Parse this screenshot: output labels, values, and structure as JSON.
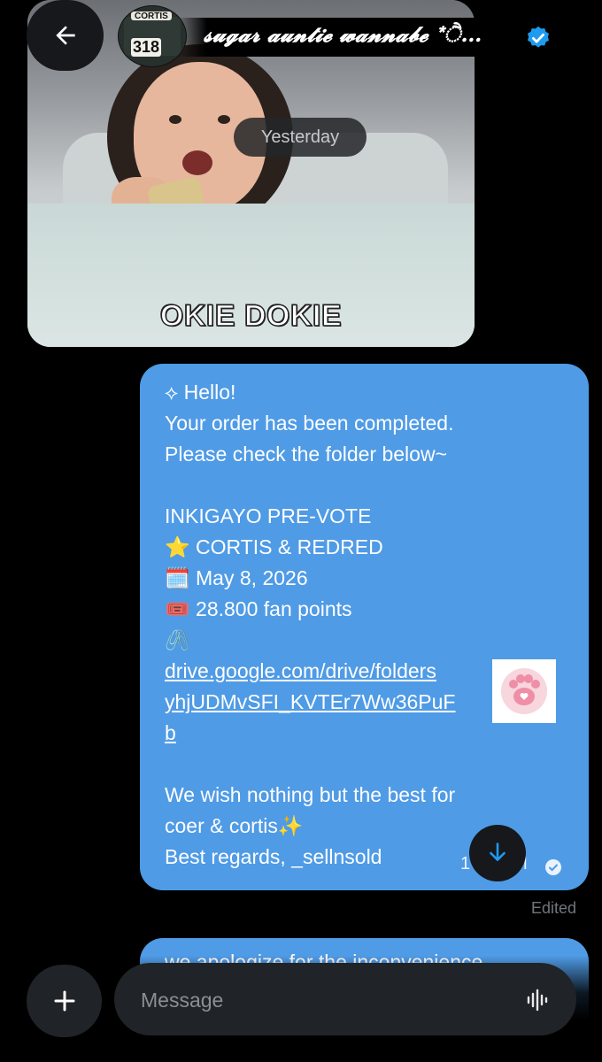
{
  "header": {
    "contact_name": "𝓼𝓾𝓰𝓪𝓻 𝓪𝓾𝓷𝓽𝓲𝓮 𝔀𝓪𝓷𝓷𝓪𝓫𝓮 *ੈ…",
    "avatar_text": "CORTIS",
    "avatar_number": "318",
    "back_icon": "arrow-left-icon",
    "verified_icon": "verified-badge-icon",
    "verified_color": "#1d9bf0"
  },
  "conversation": {
    "date_divider": "Yesterday",
    "gif_message": {
      "caption": "OKIE DOKIE"
    },
    "order_message": {
      "lines": [
        "⟡ Hello!",
        "Your order has been completed.",
        "Please check the folder below~",
        "",
        "INKIGAYO PRE-VOTE",
        "⭐ CORTIS & REDRED",
        "🗓️ May 8, 2026",
        "🎟️ 28.800 fan points",
        "🖇️"
      ],
      "link_lines": [
        "drive.google.com/drive/folders",
        "yhjUDMvSFI_KVTEr7Ww36PuF",
        "b"
      ],
      "closing_lines": [
        "",
        "We wish nothing but the best for",
        "coer & cortis✨",
        "Best regards, _sellnsold"
      ],
      "time_partial": "1",
      "time_suffix": "M",
      "status": "Edited",
      "bubble_color": "#4f9be6"
    },
    "next_message_peek": "we apologize for the inconvenience",
    "sticker_icon": "paw-print-icon"
  },
  "composer": {
    "placeholder": "Message",
    "add_icon": "plus-icon",
    "voice_icon": "voice-waveform-icon",
    "scroll_icon": "arrow-down-icon"
  }
}
